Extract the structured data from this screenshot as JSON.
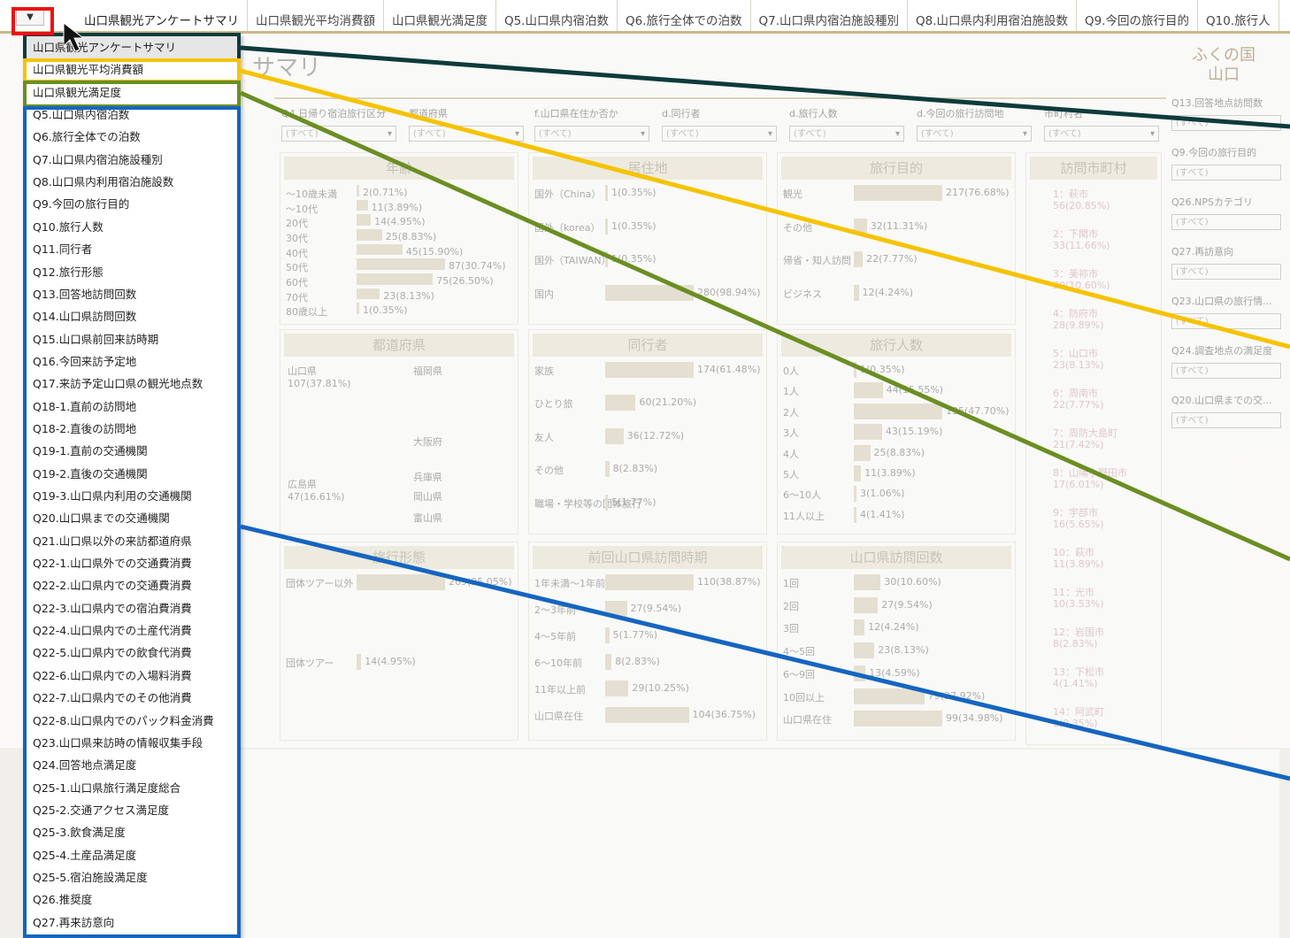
{
  "tabs": [
    "山口県観光アンケートサマリ",
    "山口県観光平均消費額",
    "山口県観光満足度",
    "Q5.山口県内宿泊数",
    "Q6.旅行全体での泊数",
    "Q7.山口県内宿泊施設種別",
    "Q8.山口県内利用宿泊施設数",
    "Q9.今回の旅行目的",
    "Q10.旅行人"
  ],
  "toggle_label": "▼",
  "menu": [
    "山口県観光アンケートサマリ",
    "山口県観光平均消費額",
    "山口県観光満足度",
    "Q5.山口県内宿泊数",
    "Q6.旅行全体での泊数",
    "Q7.山口県内宿泊施設種別",
    "Q8.山口県内利用宿泊施設数",
    "Q9.今回の旅行目的",
    "Q10.旅行人数",
    "Q11.同行者",
    "Q12.旅行形態",
    "Q13.回答地訪問回数",
    "Q14.山口県訪問回数",
    "Q15.山口県前回来訪時期",
    "Q16.今回来訪予定地",
    "Q17.来訪予定山口県の観光地点数",
    "Q18-1.直前の訪問地",
    "Q18-2.直後の訪問地",
    "Q19-1.直前の交通機関",
    "Q19-2.直後の交通機関",
    "Q19-3.山口県内利用の交通機関",
    "Q20.山口県までの交通機関",
    "Q21.山口県以外の来訪都道府県",
    "Q22-1.山口県外での交通費消費",
    "Q22-2.山口県内での交通費消費",
    "Q22-3.山口県内での宿泊費消費",
    "Q22-4.山口県内での土産代消費",
    "Q22-5.山口県内での飲食代消費",
    "Q22-6.山口県内での入場料消費",
    "Q22-7.山口県内でのその他消費",
    "Q22-8.山口県内でのパック料金消費",
    "Q23.山口県来訪時の情報収集手段",
    "Q24.回答地点満足度",
    "Q25-1.山口県旅行満足度総合",
    "Q25-2.交通アクセス満足度",
    "Q25-3.飲食満足度",
    "Q25-4.土産品満足度",
    "Q25-5.宿泊施設満足度",
    "Q26.推奨度",
    "Q27.再来訪意向"
  ],
  "dashboard": {
    "title": "サマリ",
    "logo": "ふくの国 山口",
    "filters": [
      {
        "label": "Q4.日帰り宿泊旅行区分",
        "value": "(すべて)"
      },
      {
        "label": "都道府県",
        "value": "(すべて)"
      },
      {
        "label": "f.山口県在住か否か",
        "value": "(すべて)"
      },
      {
        "label": "d.同行者",
        "value": "(すべて)"
      },
      {
        "label": "d.旅行人数",
        "value": "(すべて)"
      },
      {
        "label": "d.今回の旅行訪問地",
        "value": "(すべて)"
      },
      {
        "label": "市町村名",
        "value": "(すべて)"
      }
    ],
    "side_filters": [
      {
        "label": "Q13.回答地点訪問数",
        "value": "(すべて)"
      },
      {
        "label": "Q9.今回の旅行目的",
        "value": "(すべて)"
      },
      {
        "label": "Q26.NPSカテゴリ",
        "value": "(すべて)"
      },
      {
        "label": "Q27.再訪意向",
        "value": "(すべて)"
      },
      {
        "label": "Q23.山口県の旅行情...",
        "value": "(すべて)"
      },
      {
        "label": "Q24.調査地点の満足度",
        "value": "(すべて)"
      },
      {
        "label": "Q20.山口県までの交...",
        "value": "(すべて)"
      }
    ],
    "panels": [
      {
        "title": "年齢",
        "rows": [
          [
            "～10歳未満",
            "2(0.71%)",
            2
          ],
          [
            "～10代",
            "11(3.89%)",
            11
          ],
          [
            "20代",
            "14(4.95%)",
            14
          ],
          [
            "30代",
            "25(8.83%)",
            25
          ],
          [
            "40代",
            "45(15.90%)",
            45
          ],
          [
            "50代",
            "87(30.74%)",
            87
          ],
          [
            "60代",
            "75(26.50%)",
            75
          ],
          [
            "70代",
            "23(8.13%)",
            23
          ],
          [
            "80歳以上",
            "1(0.35%)",
            1
          ]
        ]
      },
      {
        "title": "居住地",
        "rows": [
          [
            "国外（China）",
            "1(0.35%)",
            1
          ],
          [
            "国外（korea）",
            "1(0.35%)",
            1
          ],
          [
            "国外（TAIWAN）",
            "1(0.35%)",
            1
          ],
          [
            "国内",
            "280(98.94%)",
            280
          ]
        ]
      },
      {
        "title": "旅行目的",
        "rows": [
          [
            "観光",
            "217(76.68%)",
            217
          ],
          [
            "その他",
            "32(11.31%)",
            32
          ],
          [
            "帰省・知人訪問",
            "22(7.77%)",
            22
          ],
          [
            "ビジネス",
            "12(4.24%)",
            12
          ]
        ]
      },
      {
        "title": "都道府県",
        "rows": []
      },
      {
        "title": "同行者",
        "rows": [
          [
            "家族",
            "174(61.48%)",
            174
          ],
          [
            "ひとり旅",
            "60(21.20%)",
            60
          ],
          [
            "友人",
            "36(12.72%)",
            36
          ],
          [
            "その他",
            "8(2.83%)",
            8
          ],
          [
            "職場・学校等の団体旅行",
            "5(1.77%)",
            5
          ]
        ]
      },
      {
        "title": "旅行人数",
        "rows": [
          [
            "0人",
            "1(0.35%)",
            1
          ],
          [
            "1人",
            "44(15.55%)",
            44
          ],
          [
            "2人",
            "135(47.70%)",
            135
          ],
          [
            "3人",
            "43(15.19%)",
            43
          ],
          [
            "4人",
            "25(8.83%)",
            25
          ],
          [
            "5人",
            "11(3.89%)",
            11
          ],
          [
            "6～10人",
            "3(1.06%)",
            3
          ],
          [
            "11人以上",
            "4(1.41%)",
            4
          ]
        ]
      },
      {
        "title": "旅行形態",
        "rows": [
          [
            "団体ツアー以外",
            "269(95.05%)",
            269
          ],
          [
            "団体ツアー",
            "14(4.95%)",
            14
          ]
        ]
      },
      {
        "title": "前回山口県訪問時期",
        "rows": [
          [
            "1年未満～1年前",
            "110(38.87%)",
            110
          ],
          [
            "2～3年前",
            "27(9.54%)",
            27
          ],
          [
            "4～5年前",
            "5(1.77%)",
            5
          ],
          [
            "6～10年前",
            "8(2.83%)",
            8
          ],
          [
            "11年以上前",
            "29(10.25%)",
            29
          ],
          [
            "山口県在住",
            "104(36.75%)",
            104
          ]
        ]
      },
      {
        "title": "山口県訪問回数",
        "rows": [
          [
            "1回",
            "30(10.60%)",
            30
          ],
          [
            "2回",
            "27(9.54%)",
            27
          ],
          [
            "3回",
            "12(4.24%)",
            12
          ],
          [
            "4～5回",
            "23(8.13%)",
            23
          ],
          [
            "6～9回",
            "13(4.59%)",
            13
          ],
          [
            "10回以上",
            "79(27.92%)",
            79
          ],
          [
            "山口県在住",
            "99(34.98%)",
            99
          ]
        ]
      },
      {
        "title": "訪問市町村",
        "rows": []
      }
    ],
    "prefecture_labels": [
      "山口県",
      "107(37.81%)",
      "広島県",
      "47(16.61%)",
      "福岡県",
      "大阪府",
      "兵庫県",
      "岡山県",
      "富山県"
    ],
    "city_labels": [
      "1：萩市",
      "56(20.85%)",
      "2：下関市",
      "33(11.66%)",
      "3：美祢市",
      "30(10.60%)",
      "4：防府市",
      "28(9.89%)",
      "5：山口市",
      "23(8.13%)",
      "6：周南市",
      "22(7.77%)",
      "7：周防大島町",
      "21(7.42%)",
      "8：山陽小野田市",
      "17(6.01%)",
      "9：宇部市",
      "16(5.65%)",
      "10：萩市",
      "11(3.89%)",
      "11：光市",
      "10(3.53%)",
      "12：岩国市",
      "8(2.83%)",
      "13：下松市",
      "4(1.41%)",
      "14：阿武町",
      "1(0.35%)"
    ]
  },
  "colors": {
    "highlight_red": "#e11111",
    "dark_teal": "#0d3b3b",
    "yellow": "#f5c300",
    "olive": "#6b8e23",
    "blue": "#1565c0"
  }
}
